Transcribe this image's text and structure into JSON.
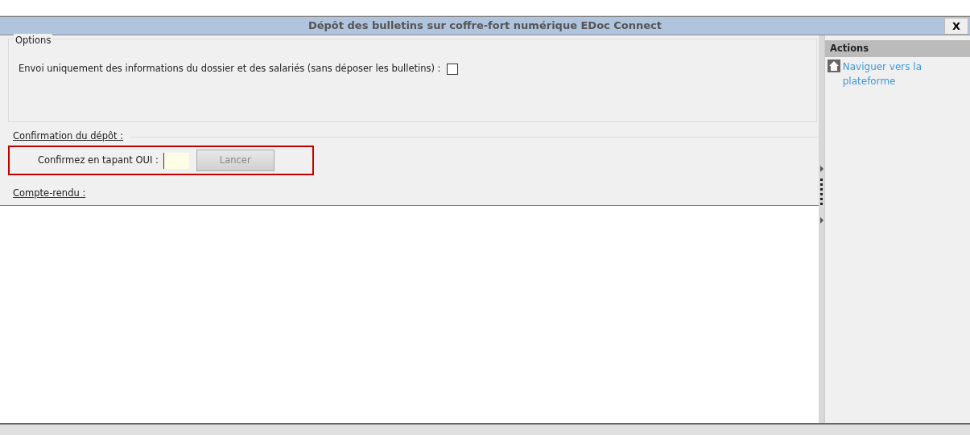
{
  "window": {
    "title": "Dépôt des bulletins sur coffre-fort numérique EDoc Connect",
    "close_label": "X"
  },
  "options": {
    "legend": "Options",
    "send_info_only": {
      "label": "Envoi uniquement des informations du dossier et des salariés (sans déposer les bulletins)  :",
      "checked": false
    }
  },
  "confirmation": {
    "heading": "Confirmation du dépôt :",
    "prompt": "Confirmez en tapant OUI :",
    "highlighted": true,
    "launch_button": {
      "label": "Lancer",
      "disabled": true
    }
  },
  "report": {
    "heading": "Compte-rendu :"
  },
  "actions": {
    "title": "Actions",
    "items": [
      {
        "label": "Naviguer vers la plateforme"
      }
    ]
  }
}
